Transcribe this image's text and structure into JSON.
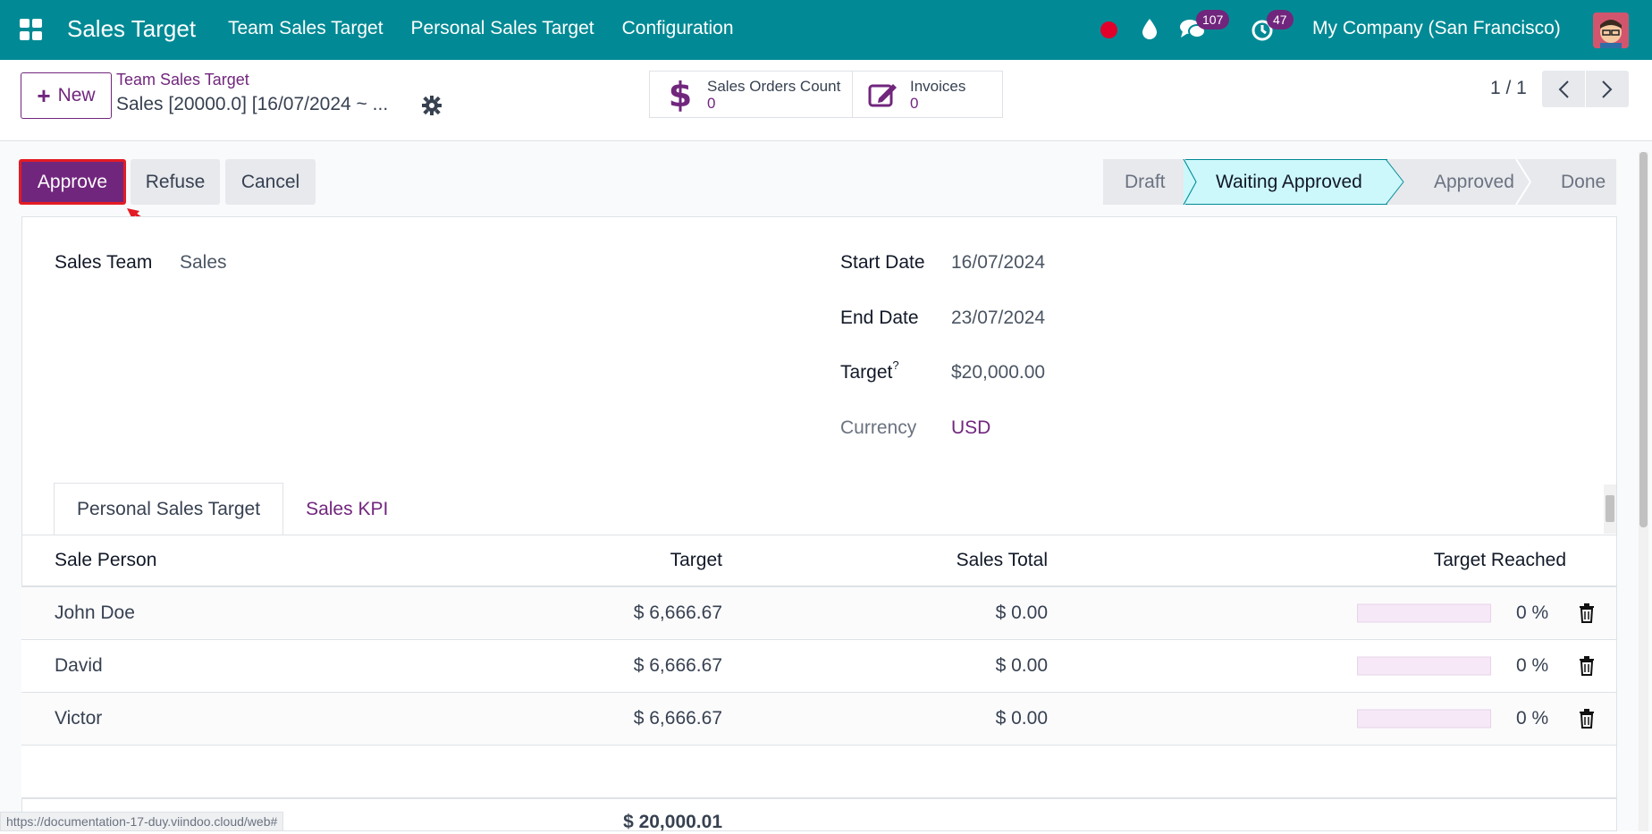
{
  "navbar": {
    "brand": "Sales Target",
    "menu": [
      "Team Sales Target",
      "Personal Sales Target",
      "Configuration"
    ],
    "messages_count": "107",
    "activities_count": "47",
    "company": "My Company (San Francisco)"
  },
  "control": {
    "new_label": "New",
    "breadcrumb_parent": "Team Sales Target",
    "breadcrumb_current": "Sales [20000.0] [16/07/2024 ~ ...",
    "stat_sales_label": "Sales Orders Count",
    "stat_sales_value": "0",
    "stat_invoices_label": "Invoices",
    "stat_invoices_value": "0",
    "pager": "1 / 1"
  },
  "actions": {
    "approve": "Approve",
    "refuse": "Refuse",
    "cancel": "Cancel"
  },
  "statusbar": {
    "stages": [
      "Draft",
      "Waiting Approved",
      "Approved",
      "Done"
    ],
    "active": "Waiting Approved"
  },
  "form": {
    "sales_team_label": "Sales Team",
    "sales_team_value": "Sales",
    "start_date_label": "Start Date",
    "start_date_value": "16/07/2024",
    "end_date_label": "End Date",
    "end_date_value": "23/07/2024",
    "target_label": "Target",
    "target_tooltip": "?",
    "target_value": "$20,000.00",
    "currency_label": "Currency",
    "currency_value": "USD"
  },
  "tabs": [
    "Personal Sales Target",
    "Sales KPI"
  ],
  "table": {
    "headers": [
      "Sale Person",
      "Target",
      "Sales Total",
      "Target Reached"
    ],
    "rows": [
      {
        "person": "John Doe",
        "target": "$ 6,666.67",
        "sales_total": "$ 0.00",
        "reached": "0 %",
        "progress": 0
      },
      {
        "person": "David",
        "target": "$ 6,666.67",
        "sales_total": "$ 0.00",
        "reached": "0 %",
        "progress": 0
      },
      {
        "person": "Victor",
        "target": "$ 6,666.67",
        "sales_total": "$ 0.00",
        "reached": "0 %",
        "progress": 0
      }
    ],
    "total_target": "$ 20,000.01"
  },
  "status_url": "https://documentation-17-duy.viindoo.cloud/web#",
  "colors": {
    "navbar": "#018a95",
    "primary": "#71267d",
    "active_stage": "#ccf8fb",
    "annotation": "#e31b23"
  }
}
